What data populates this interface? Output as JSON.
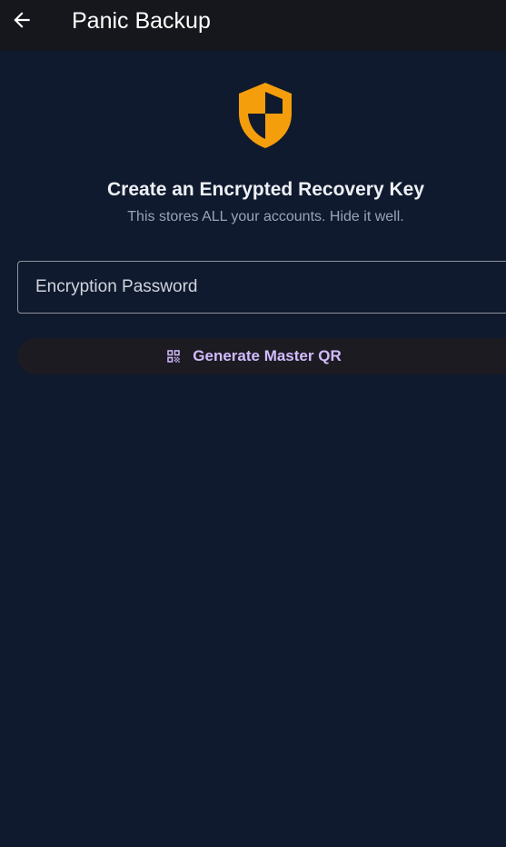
{
  "appbar": {
    "title": "Panic Backup",
    "back_icon": "arrow-back-icon"
  },
  "main": {
    "icon": "shield-icon",
    "heading": "Create an Encrypted Recovery Key",
    "subheading": "This stores ALL your accounts. Hide it well.",
    "password_field": {
      "placeholder": "Encryption Password",
      "value": ""
    },
    "generate_button": {
      "label": "Generate Master QR",
      "icon": "qr-code-icon"
    }
  },
  "colors": {
    "background": "#101a2e",
    "appbar": "#16171c",
    "shield": "#f59e0b",
    "button_text": "#d2bcfd",
    "button_bg": "#1c1b22"
  }
}
